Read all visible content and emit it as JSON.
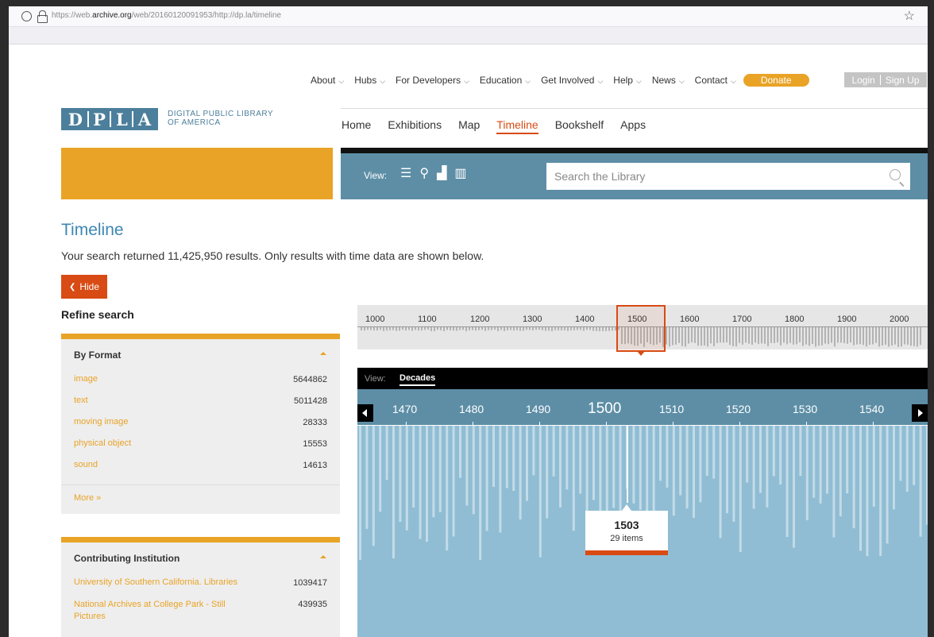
{
  "browser": {
    "url_prefix": "https://web.",
    "url_domain": "archive.org",
    "url_rest": "/web/20160120091953/http://dp.la/timeline"
  },
  "topnav": [
    "About",
    "Hubs",
    "For Developers",
    "Education",
    "Get Involved",
    "Help",
    "News",
    "Contact"
  ],
  "donate_label": "Donate",
  "login_label": "Login",
  "signup_label": "Sign Up",
  "logo": {
    "letters": [
      "D",
      "P",
      "L",
      "A"
    ],
    "line1": "DIGITAL PUBLIC LIBRARY",
    "line2": "OF AMERICA"
  },
  "mainnav": [
    "Home",
    "Exhibitions",
    "Map",
    "Timeline",
    "Bookshelf",
    "Apps"
  ],
  "mainnav_active": "Timeline",
  "view_label": "View:",
  "view_icons": [
    "list-icon",
    "map-pin-icon",
    "timeline-icon",
    "bookshelf-icon"
  ],
  "search_placeholder": "Search the Library",
  "page_title": "Timeline",
  "results_text": "Your search returned 11,425,950 results. Only results with time data are shown below.",
  "hide_label": "Hide",
  "refine_label": "Refine search",
  "facets": {
    "format": {
      "title": "By Format",
      "items": [
        {
          "name": "image",
          "count": "5644862"
        },
        {
          "name": "text",
          "count": "5011428"
        },
        {
          "name": "moving image",
          "count": "28333"
        },
        {
          "name": "physical object",
          "count": "15553"
        },
        {
          "name": "sound",
          "count": "14613"
        }
      ],
      "more": "More »"
    },
    "institution": {
      "title": "Contributing Institution",
      "items": [
        {
          "name": "University of Southern California. Libraries",
          "count": "1039417"
        },
        {
          "name": "National Archives at College Park - Still Pictures",
          "count": "439935"
        }
      ]
    }
  },
  "timeline": {
    "overview_years": [
      "1000",
      "1100",
      "1200",
      "1300",
      "1400",
      "1500",
      "1600",
      "1700",
      "1800",
      "1900",
      "2000"
    ],
    "view_label": "View:",
    "view_mode": "Decades",
    "detail_years": [
      "1470",
      "1480",
      "1490",
      "1500",
      "1510",
      "1520",
      "1530",
      "1540"
    ],
    "current_year": "1500",
    "tooltip_year": "1503",
    "tooltip_items": "29 items"
  },
  "colors": {
    "accent_orange": "#e9a326",
    "active_red": "#d84b14",
    "brand_blue": "#4c7f9b",
    "timeline_blue": "#90bdd3"
  }
}
